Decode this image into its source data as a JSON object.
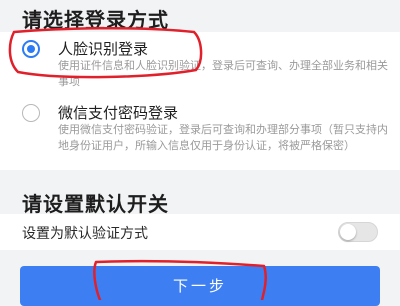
{
  "login_section": {
    "title": "请选择登录方式",
    "options": [
      {
        "label": "人脸识别登录",
        "description": "使用证件信息和人脸识别验证，登录后可查询、办理全部业务和相关事项",
        "selected": true
      },
      {
        "label": "微信支付密码登录",
        "description": "使用微信支付密码验证，登录后可查询和办理部分事项（暂只支持内地身份证用户，所输入信息仅用于身份认证，将被严格保密）",
        "selected": false
      }
    ]
  },
  "default_section": {
    "title": "请设置默认开关",
    "toggle_label": "设置为默认验证方式",
    "toggle_on": false
  },
  "next_button": {
    "label": "下一步"
  },
  "colors": {
    "accent": "#2b7cf6",
    "annotation": "#e0202a"
  }
}
